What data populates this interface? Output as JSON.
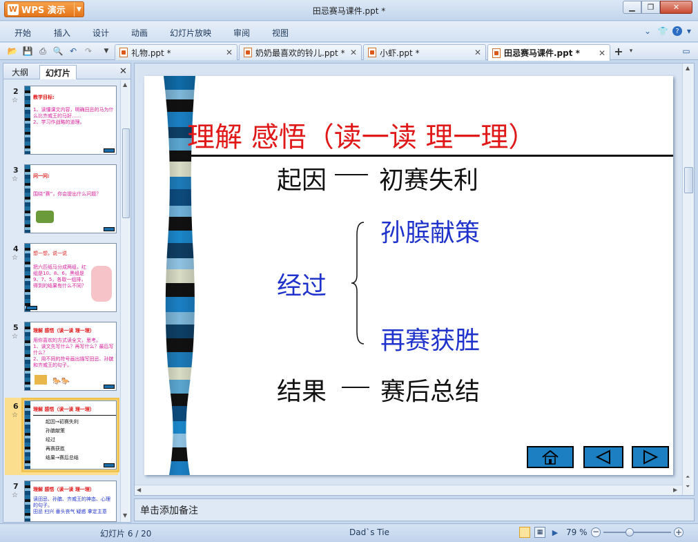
{
  "app": {
    "name": "WPS 演示",
    "doc_title": "田忌赛马课件.ppt *"
  },
  "window": {
    "min_icon": "minimize-icon",
    "max_icon": "maximize-icon",
    "close_icon": "close-icon"
  },
  "menu": {
    "items": [
      "开始",
      "插入",
      "设计",
      "动画",
      "幻灯片放映",
      "审阅",
      "视图"
    ],
    "right_icons": [
      "chevron-down-icon",
      "shirt-icon",
      "help-icon"
    ]
  },
  "quick_access": [
    "open-icon",
    "save-icon",
    "print-icon",
    "print-preview-icon",
    "undo-icon",
    "redo-icon",
    "customize-dropdown-icon"
  ],
  "tabs": [
    {
      "label": "礼物.ppt *",
      "active": false
    },
    {
      "label": "奶奶最喜欢的铃儿.ppt *",
      "active": false
    },
    {
      "label": "小虾.ppt *",
      "active": false
    },
    {
      "label": "田忌赛马课件.ppt *",
      "active": true
    }
  ],
  "left_pane": {
    "tab_outline": "大纲",
    "tab_slides": "幻灯片"
  },
  "thumbnails": [
    {
      "num": "2",
      "title": "教学目标:",
      "body": "1、读懂课文内容，明确田忌的马为什么比齐威王的马好......\n2、学习作战略的道理。"
    },
    {
      "num": "3",
      "title": "问一问:",
      "body": "围绕“赛”，你会提出什么问题？"
    },
    {
      "num": "4",
      "title": "想一想，说一说",
      "body": "把六匹纸马分成两组，红组是10、8、6，黑组是9、7、5，各取一组排，得到的结果有什么不同？"
    },
    {
      "num": "5",
      "title": "理解 感悟（读一读 理一理）",
      "body": "用你喜欢的方式读全文，思考。\n1、读文先写什么？再写什么？最后写什么？\n2、用不同的符号画出描写田忌、孙膑和齐威王的句子。"
    },
    {
      "num": "6",
      "title": "理解 感悟（读一读 理一理）",
      "body": "起因→初赛失利\n孙膑献策\n经过\n再赛获胜\n结果→赛后总结",
      "selected": true
    },
    {
      "num": "7",
      "title": "理解 感悟（读一读 理一理）",
      "body": "读田忌、孙膑、齐威王的神态、心理的句子。\n田忌 扫兴 垂头丧气 疑惑 拿定主意"
    }
  ],
  "slide": {
    "title": "理解  感悟（读一读  理一理）",
    "cause_label": "起因",
    "cause_result": "初赛失利",
    "process_label": "经过",
    "process_item1": "孙膑献策",
    "process_item2": "再赛获胜",
    "result_label": "结果",
    "result_text": "赛后总结",
    "nav": [
      "home-icon",
      "prev-icon",
      "next-icon"
    ],
    "colors": {
      "title": "#e01818",
      "blue": "#1f33cc",
      "nav": "#1b7fc2"
    }
  },
  "notes_placeholder": "单击添加备注",
  "status": {
    "slide_info": "幻灯片 6 / 20",
    "theme": "Dad`s Tie",
    "zoom": "79 %"
  }
}
